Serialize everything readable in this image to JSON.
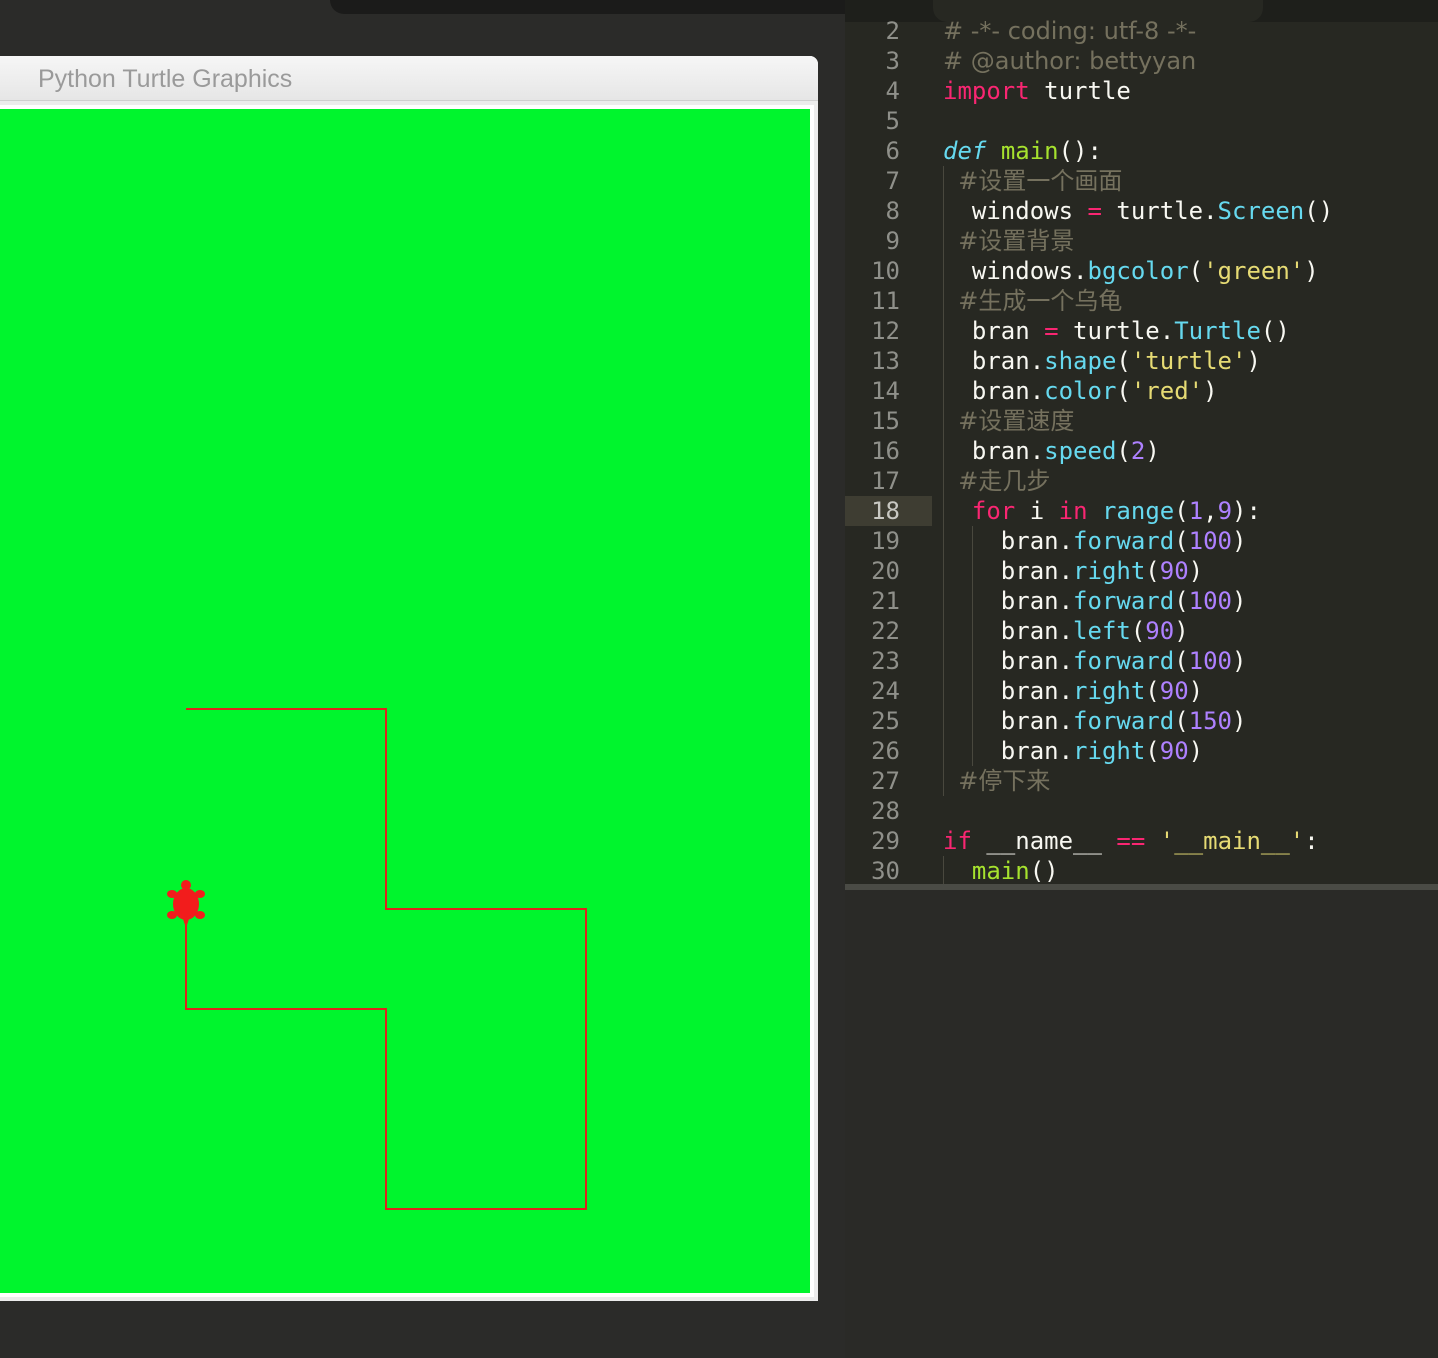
{
  "window": {
    "title": "Python Turtle Graphics"
  },
  "canvas": {
    "background": "#00f52d",
    "pen_color": "#e0231d",
    "turtle_color": "#f21c1c"
  },
  "editor": {
    "theme": {
      "background": "#272822",
      "keyword": "#f92672",
      "string": "#e6db74",
      "number": "#ae81ff",
      "method": "#66d9ef",
      "comment": "#75715e"
    },
    "active_line": 18,
    "lines": [
      {
        "n": "2",
        "text": "# -*- coding: utf-8 -*-"
      },
      {
        "n": "3",
        "text": "# @author: bettyyan"
      },
      {
        "n": "4",
        "text": "import turtle"
      },
      {
        "n": "5",
        "text": ""
      },
      {
        "n": "6",
        "text": "def main():"
      },
      {
        "n": "7",
        "text": "  #设置一个画面"
      },
      {
        "n": "8",
        "text": "  windows = turtle.Screen()"
      },
      {
        "n": "9",
        "text": "  #设置背景"
      },
      {
        "n": "10",
        "text": "  windows.bgcolor('green')"
      },
      {
        "n": "11",
        "text": "  #生成一个乌龟"
      },
      {
        "n": "12",
        "text": "  bran = turtle.Turtle()"
      },
      {
        "n": "13",
        "text": "  bran.shape('turtle')"
      },
      {
        "n": "14",
        "text": "  bran.color('red')"
      },
      {
        "n": "15",
        "text": "  #设置速度"
      },
      {
        "n": "16",
        "text": "  bran.speed(2)"
      },
      {
        "n": "17",
        "text": "  #走几步"
      },
      {
        "n": "18",
        "text": "  for i in range(1,9):"
      },
      {
        "n": "19",
        "text": "    bran.forward(100)"
      },
      {
        "n": "20",
        "text": "    bran.right(90)"
      },
      {
        "n": "21",
        "text": "    bran.forward(100)"
      },
      {
        "n": "22",
        "text": "    bran.left(90)"
      },
      {
        "n": "23",
        "text": "    bran.forward(100)"
      },
      {
        "n": "24",
        "text": "    bran.right(90)"
      },
      {
        "n": "25",
        "text": "    bran.forward(150)"
      },
      {
        "n": "26",
        "text": "    bran.right(90)"
      },
      {
        "n": "27",
        "text": "  #停下来"
      },
      {
        "n": "28",
        "text": ""
      },
      {
        "n": "29",
        "text": "if __name__ == '__main__':"
      },
      {
        "n": "30",
        "text": "  main()"
      }
    ]
  }
}
